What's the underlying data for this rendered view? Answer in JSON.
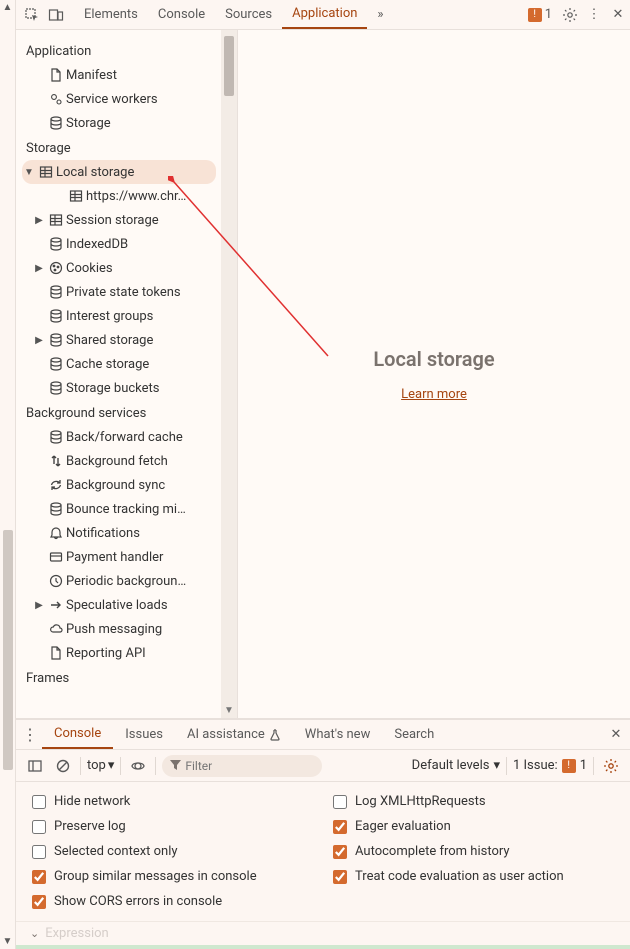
{
  "top_tabs": {
    "elements": "Elements",
    "console": "Console",
    "sources": "Sources",
    "application": "Application",
    "more": "»",
    "issues_count": "1"
  },
  "sidebar": {
    "sections": {
      "application": "Application",
      "storage": "Storage",
      "background": "Background services",
      "frames": "Frames"
    },
    "app": {
      "manifest": "Manifest",
      "service_workers": "Service workers",
      "storage": "Storage"
    },
    "storage": {
      "local_storage": "Local storage",
      "local_origin": "https://www.chr…",
      "session_storage": "Session storage",
      "indexeddb": "IndexedDB",
      "cookies": "Cookies",
      "pst": "Private state tokens",
      "interest": "Interest groups",
      "shared": "Shared storage",
      "cache": "Cache storage",
      "buckets": "Storage buckets"
    },
    "bg": {
      "bfcache": "Back/forward cache",
      "bgfetch": "Background fetch",
      "bgsync": "Background sync",
      "bounce": "Bounce tracking mi…",
      "notifications": "Notifications",
      "payment": "Payment handler",
      "periodic": "Periodic backgroun…",
      "speculative": "Speculative loads",
      "push": "Push messaging",
      "reporting": "Reporting API"
    }
  },
  "main": {
    "title": "Local storage",
    "learn_more": "Learn more"
  },
  "drawer": {
    "tabs": {
      "console": "Console",
      "issues": "Issues",
      "ai": "AI assistance",
      "whats_new": "What's new",
      "search": "Search"
    },
    "toolbar": {
      "context": "top",
      "filter_placeholder": "Filter",
      "levels": "Default levels",
      "issues_label": "1 Issue:",
      "issues_count": "1"
    },
    "settings": {
      "hide_network": {
        "label": "Hide network",
        "checked": false
      },
      "log_xhr": {
        "label": "Log XMLHttpRequests",
        "checked": false
      },
      "preserve_log": {
        "label": "Preserve log",
        "checked": false
      },
      "eager_eval": {
        "label": "Eager evaluation",
        "checked": true
      },
      "selected_ctx": {
        "label": "Selected context only",
        "checked": false
      },
      "autocomplete": {
        "label": "Autocomplete from history",
        "checked": true
      },
      "group_similar": {
        "label": "Group similar messages in console",
        "checked": true
      },
      "treat_user": {
        "label": "Treat code evaluation as user action",
        "checked": true
      },
      "show_cors": {
        "label": "Show CORS errors in console",
        "checked": true
      }
    },
    "expression_placeholder": "Expression"
  }
}
